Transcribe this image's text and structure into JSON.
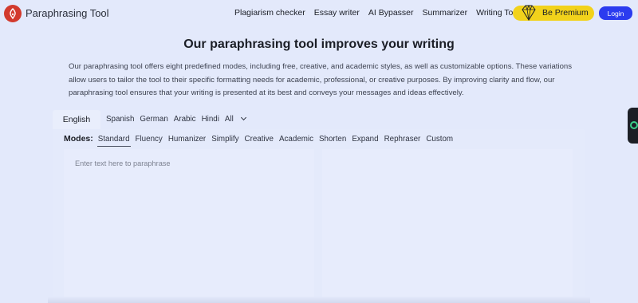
{
  "header": {
    "brand": "Paraphrasing Tool",
    "logo_icon": "pen-nib-icon",
    "nav": [
      "Plagiarism checker",
      "Essay writer",
      "AI Bypasser",
      "Summarizer",
      "Writing Tools"
    ],
    "premium_label": "Be Premium",
    "premium_icon": "diamond-icon",
    "login_label": "Login"
  },
  "hero": {
    "title": "Our paraphrasing tool improves your writing",
    "description": "Our paraphrasing tool offers eight predefined modes, including free, creative, and academic styles, as well as customizable options. These variations allow users to tailor the tool to their specific formatting needs for academic, professional, or creative purposes. By improving clarity and flow, our paraphrasing tool ensures that your writing is presented at its best and conveys your messages and ideas effectively."
  },
  "languages": {
    "active": "English",
    "others": [
      "Spanish",
      "German",
      "Arabic",
      "Hindi",
      "All"
    ]
  },
  "modes": {
    "label": "Modes:",
    "items": [
      "Standard",
      "Fluency",
      "Humanizer",
      "Simplify",
      "Creative",
      "Academic",
      "Shorten",
      "Expand",
      "Rephraser",
      "Custom"
    ],
    "active": "Standard"
  },
  "editor": {
    "input_placeholder": "Enter text here to paraphrase",
    "input_value": ""
  },
  "colors": {
    "background": "#e3e9fb",
    "login": "#2b3bef",
    "premium": "#f2d21b",
    "logo": "#d23a2d"
  }
}
